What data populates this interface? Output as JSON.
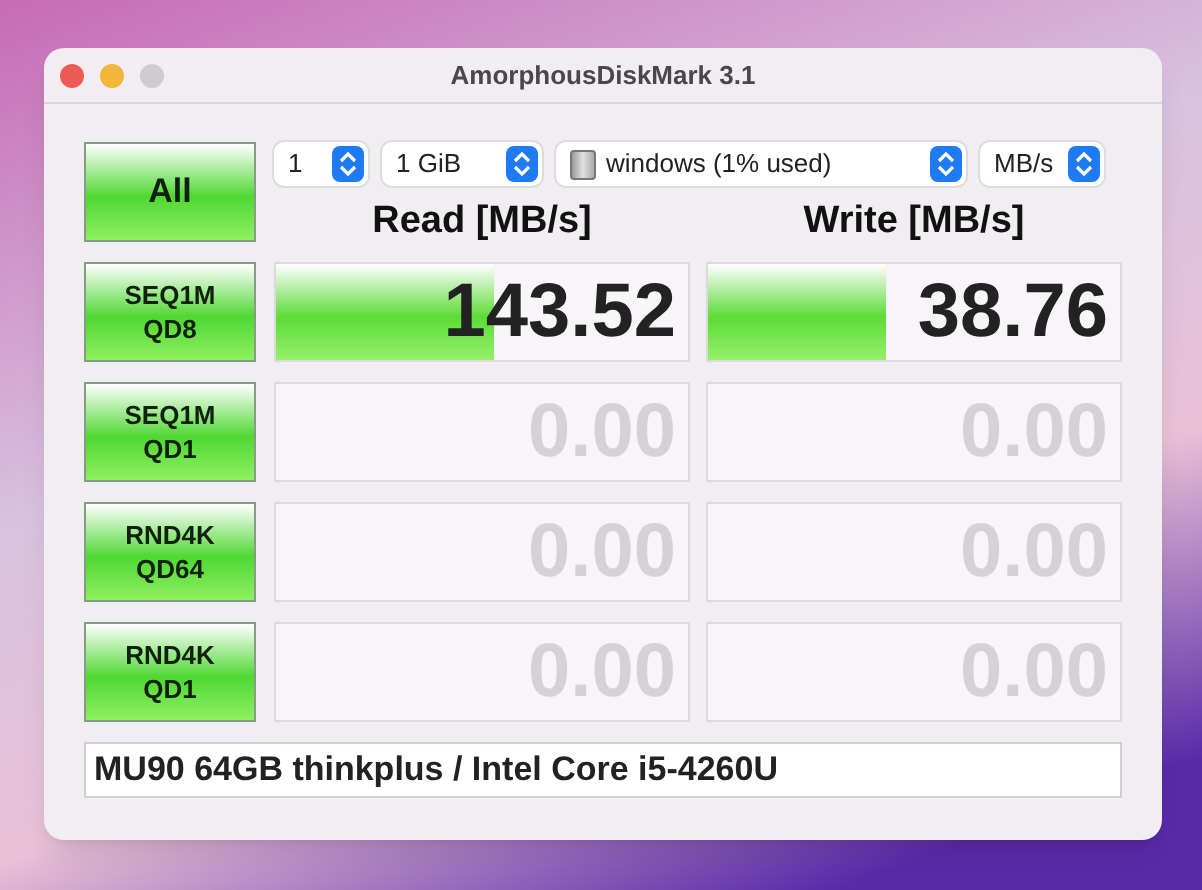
{
  "window": {
    "title": "AmorphousDiskMark 3.1"
  },
  "all_button": {
    "label": "All"
  },
  "selects": [
    {
      "kind": "plain",
      "value": "1"
    },
    {
      "kind": "plain",
      "value": "1 GiB"
    },
    {
      "kind": "drive",
      "value": "windows (1% used)"
    },
    {
      "kind": "plain",
      "value": "MB/s"
    }
  ],
  "headers": [
    {
      "label": "Read",
      "unit": "[MB/s]"
    },
    {
      "label": "Write",
      "unit": "[MB/s]"
    }
  ],
  "tests": [
    {
      "label": "SEQ1M\nQD8",
      "read": {
        "value": "143.52",
        "level": 0.53
      },
      "write": {
        "value": "38.76",
        "level": 0.43
      }
    },
    {
      "label": "SEQ1M\nQD1",
      "read": {
        "value": "0.00"
      },
      "write": {
        "value": "0.00"
      }
    },
    {
      "label": "RND4K\nQD64",
      "read": {
        "value": "0.00"
      },
      "write": {
        "value": "0.00"
      }
    },
    {
      "label": "RND4K\nQD1",
      "read": {
        "value": "0.00"
      },
      "write": {
        "value": "0.00"
      }
    }
  ],
  "comment": {
    "value": "MU90 64GB thinkplus / Intel Core i5-4260U"
  }
}
